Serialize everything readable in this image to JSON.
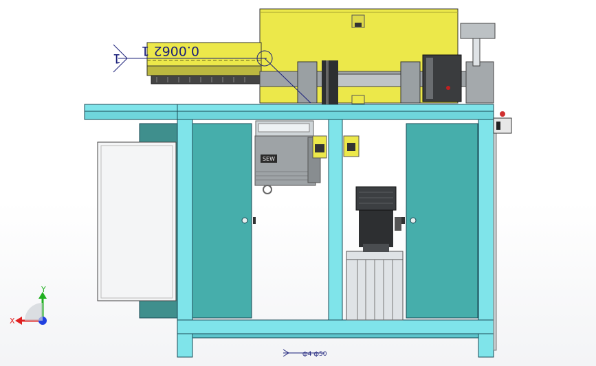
{
  "viewport": {
    "background": "#ffffff"
  },
  "dimension_annotation": {
    "text_upper": "0.0062 1",
    "leader_mark": "1",
    "color": "#1a1f7a"
  },
  "motor_nameplate": "SEW",
  "bottom_annotation": "ф4 ф50",
  "triad": {
    "x_label": "X",
    "y_label": "Y",
    "x_color": "#e02020",
    "y_color": "#20b020",
    "z_color": "#2040e0"
  },
  "colors": {
    "frame_cyan": "#7fe4ea",
    "frame_outline": "#1b4a55",
    "door_teal": "#46aeab",
    "housing_yellow": "#ece84a",
    "grey_motor": "#9ea3a6",
    "dark_motor": "#2d2f31"
  }
}
